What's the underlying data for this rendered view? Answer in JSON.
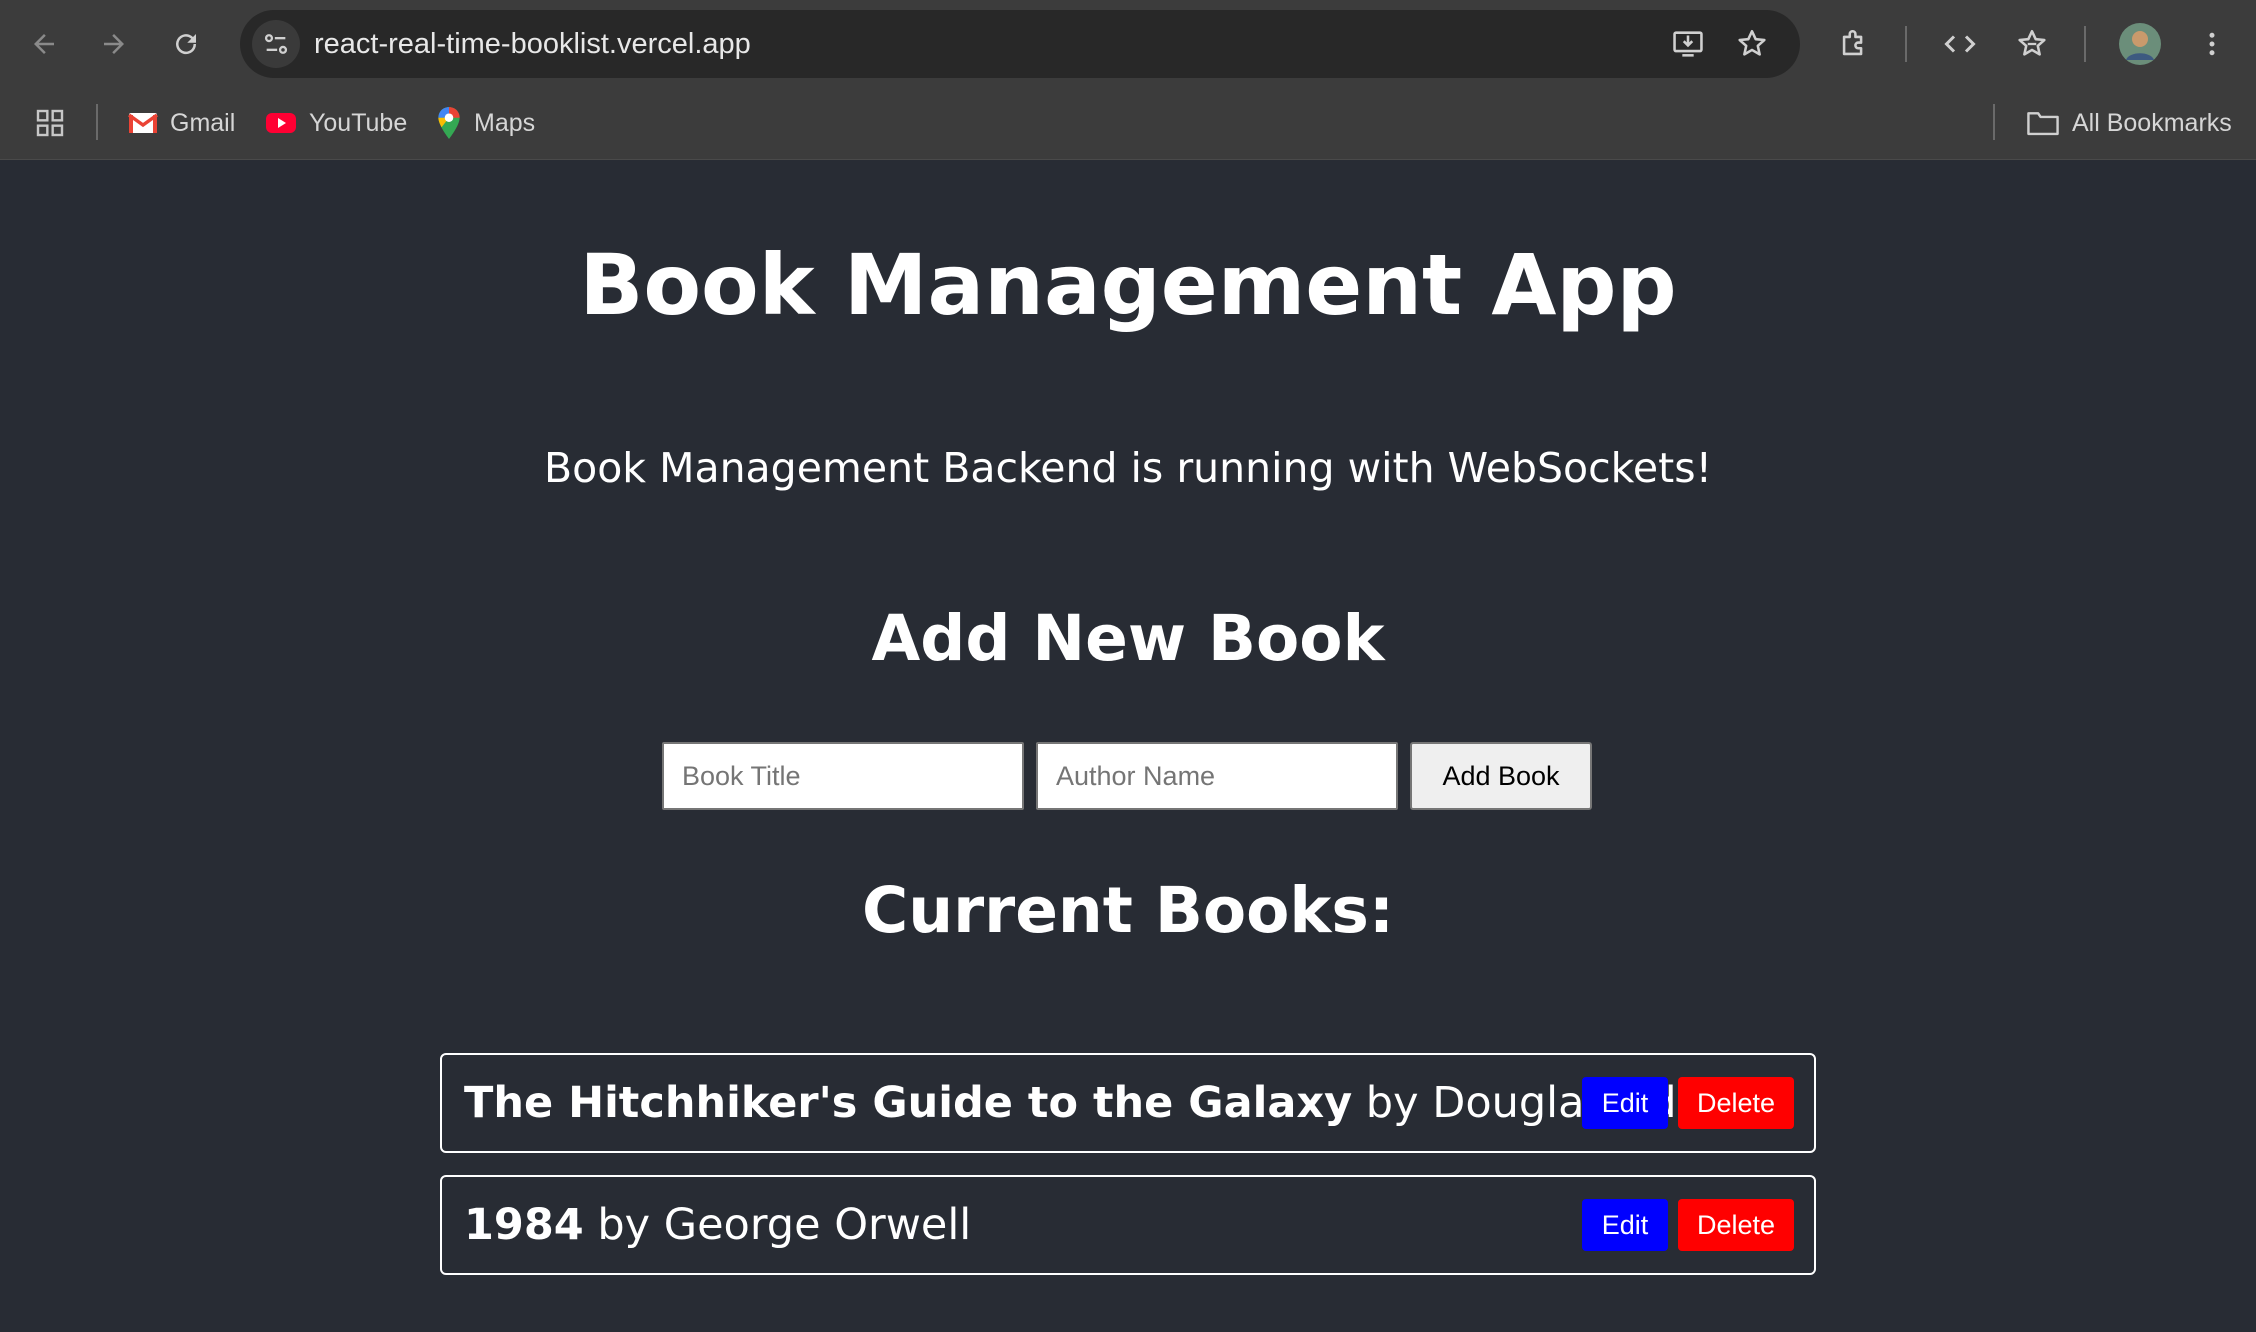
{
  "browser": {
    "url": "react-real-time-booklist.vercel.app",
    "icons": [
      "back-arrow-icon",
      "forward-arrow-icon",
      "reload-icon",
      "site-info-icon",
      "install-app-icon",
      "bookmark-star-icon",
      "extensions-icon",
      "code-icon",
      "reading-list-icon",
      "profile-avatar",
      "more-menu-icon"
    ],
    "bookmarks": {
      "items": [
        {
          "label": "Gmail",
          "icon": "gmail-icon"
        },
        {
          "label": "YouTube",
          "icon": "youtube-icon"
        },
        {
          "label": "Maps",
          "icon": "maps-icon"
        }
      ],
      "all_bookmarks": "All Bookmarks"
    }
  },
  "app": {
    "title": "Book Management App",
    "status_message": "Book Management Backend is running with WebSockets!",
    "add_section": {
      "heading": "Add New Book",
      "title_placeholder": "Book Title",
      "author_placeholder": "Author Name",
      "title_value": "",
      "author_value": "",
      "add_button": "Add Book"
    },
    "list_section": {
      "heading": "Current Books:",
      "books": [
        {
          "title": "The Hitchhiker's Guide to the Galaxy",
          "by": " by Douglas Adams",
          "edit": "Edit",
          "delete": "Delete"
        },
        {
          "title": "1984",
          "by": " by George Orwell",
          "edit": "Edit",
          "delete": "Delete"
        }
      ]
    }
  },
  "colors": {
    "page_background": "#282c34",
    "edit_button": "#0000ff",
    "delete_button": "#ff0000",
    "chrome_toolbar": "#3c3c3c"
  }
}
